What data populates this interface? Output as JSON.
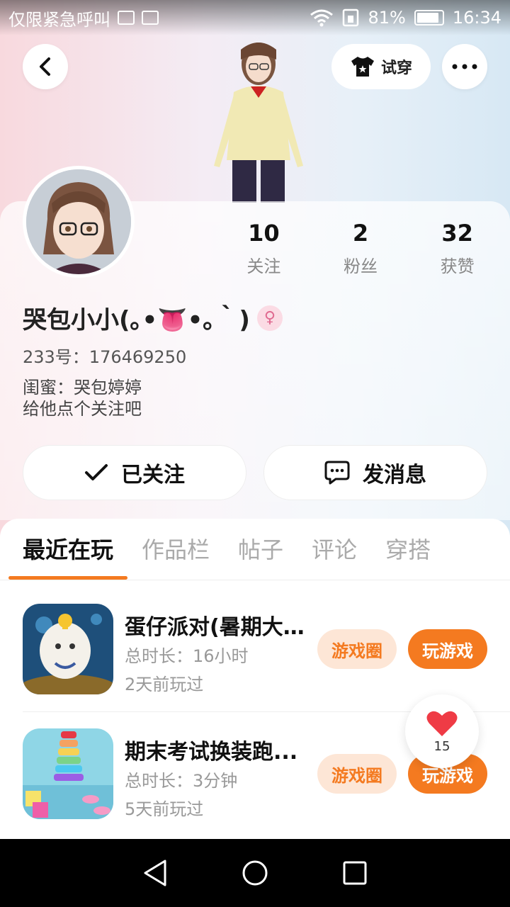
{
  "status_bar": {
    "carrier_text": "仅限紧急呼叫",
    "battery": "81%",
    "time": "16:34"
  },
  "header": {
    "back_icon": "chevron-left-icon",
    "tryon_label": "试穿",
    "more_icon": "more-dots-icon"
  },
  "profile": {
    "stats": [
      {
        "value": "10",
        "label": "关注"
      },
      {
        "value": "2",
        "label": "粉丝"
      },
      {
        "value": "32",
        "label": "获赞"
      }
    ],
    "username": "哭包小小(｡•👅•｡｀)",
    "gender_icon": "female-icon",
    "id_line": "233号：176469250",
    "bio_line1": "闺蜜：哭包婷婷",
    "bio_line2": "给他点个关注吧"
  },
  "actions": {
    "follow_label": "已关注",
    "message_label": "发消息"
  },
  "tabs": [
    "最近在玩",
    "作品栏",
    "帖子",
    "评论",
    "穿搭"
  ],
  "games": [
    {
      "title": "蛋仔派对(暑期大...",
      "duration": "总时长：16小时",
      "last_played": "2天前玩过",
      "circle_label": "游戏圈",
      "play_label": "玩游戏"
    },
    {
      "title": "期末考试换装跑...",
      "duration": "总时长：3分钟",
      "last_played": "5天前玩过",
      "circle_label": "游戏圈",
      "play_label": "玩游戏"
    }
  ],
  "floating_like": {
    "count": "15"
  },
  "colors": {
    "accent": "#f47a20",
    "accent_light": "#fde6d6"
  }
}
